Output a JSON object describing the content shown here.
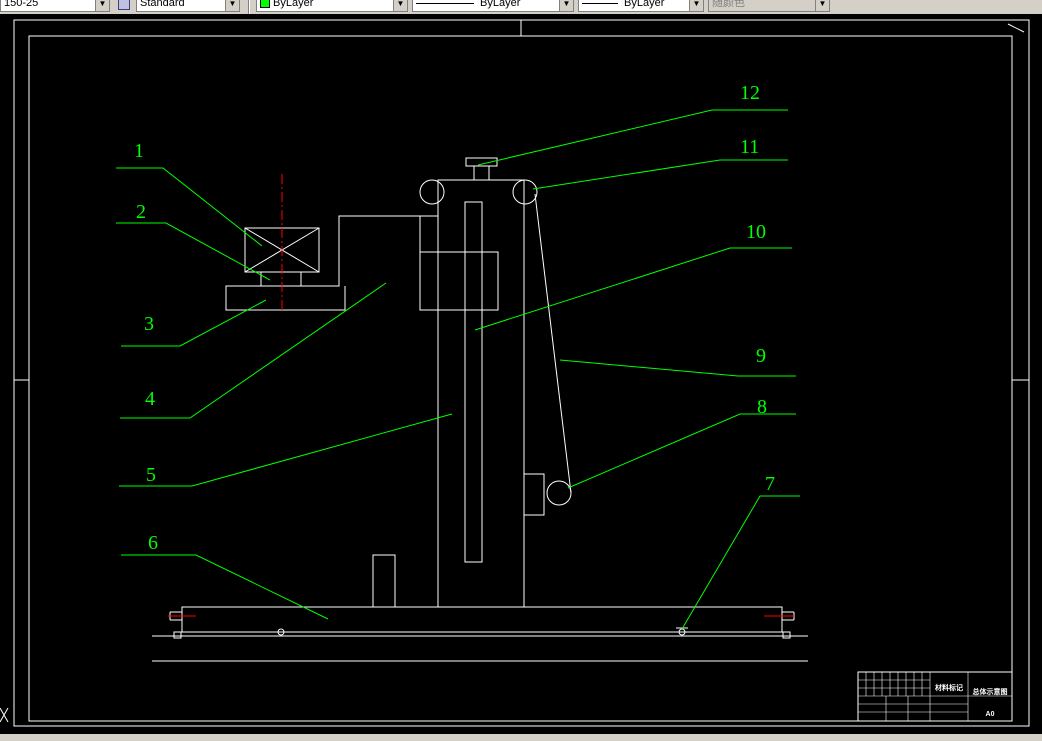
{
  "toolbar": {
    "dimstyle_value": "150-25",
    "textstyle_value": "Standard",
    "layer_value": "ByLayer",
    "linetype_value": "ByLayer",
    "lineweight_value": "ByLayer",
    "plotstyle_value": "随颜色"
  },
  "drawing": {
    "balloons": [
      "1",
      "2",
      "3",
      "4",
      "5",
      "6",
      "7",
      "8",
      "9",
      "10",
      "11",
      "12"
    ],
    "title_block": {
      "label_a": "材料标记",
      "label_b": "总体示意图",
      "label_c": "A0"
    }
  },
  "colors": {
    "background": "#000000",
    "geometry": "#ffffff",
    "leaders": "#00ff00",
    "centerline": "#ff0000"
  }
}
